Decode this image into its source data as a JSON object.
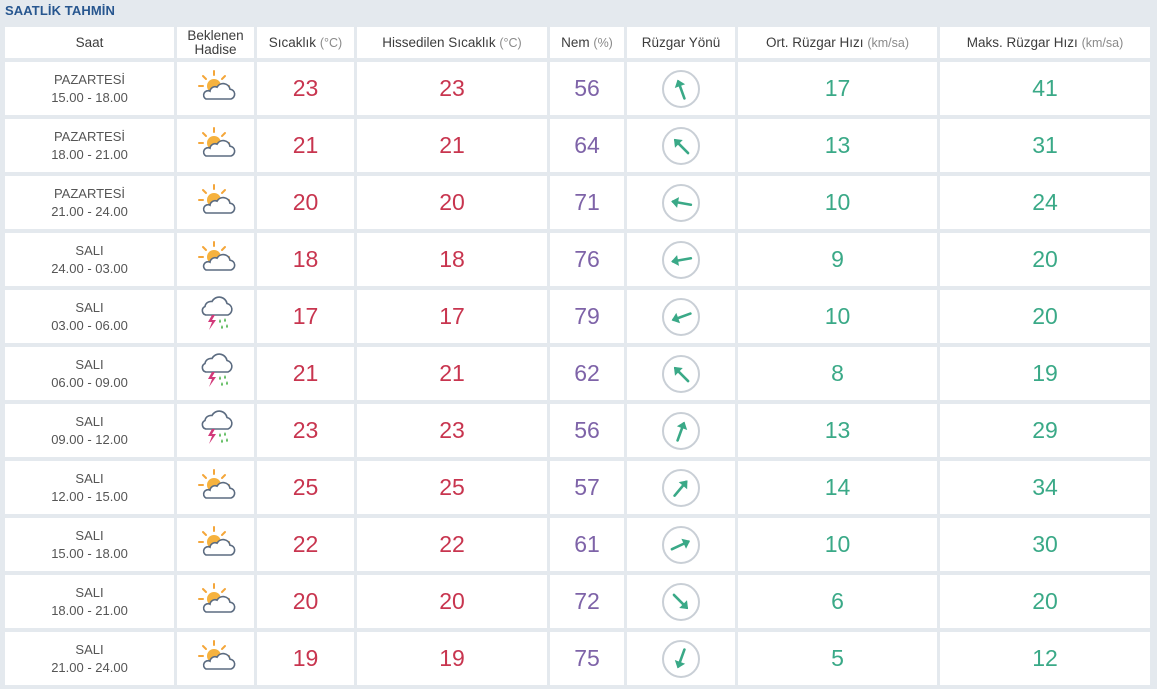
{
  "title": "SAATLİK TAHMİN",
  "headers": {
    "time": "Saat",
    "event_1": "Beklenen",
    "event_2": "Hadise",
    "temp": "Sıcaklık",
    "temp_unit": "(°C)",
    "feels": "Hissedilen Sıcaklık",
    "feels_unit": "(°C)",
    "hum": "Nem",
    "hum_unit": "(%)",
    "dir": "Rüzgar Yönü",
    "avg": "Ort. Rüzgar Hızı",
    "avg_unit": "(km/sa)",
    "max": "Maks. Rüzgar Hızı",
    "max_unit": "(km/sa)"
  },
  "colors": {
    "temp": "#c8354f",
    "humidity": "#7e63a8",
    "wind": "#3aa987",
    "title": "#27568f"
  },
  "rows": [
    {
      "day": "PAZARTESİ",
      "time": "15.00 - 18.00",
      "icon": "partly-sunny-icon",
      "temp": "23",
      "feels": "23",
      "hum": "56",
      "dir_deg": 160,
      "avg": "17",
      "max": "41"
    },
    {
      "day": "PAZARTESİ",
      "time": "18.00 - 21.00",
      "icon": "partly-sunny-icon",
      "temp": "21",
      "feels": "21",
      "hum": "64",
      "dir_deg": 135,
      "avg": "13",
      "max": "31"
    },
    {
      "day": "PAZARTESİ",
      "time": "21.00 - 24.00",
      "icon": "partly-sunny-icon",
      "temp": "20",
      "feels": "20",
      "hum": "71",
      "dir_deg": 100,
      "avg": "10",
      "max": "24"
    },
    {
      "day": "SALI",
      "time": "24.00 - 03.00",
      "icon": "partly-sunny-icon",
      "temp": "18",
      "feels": "18",
      "hum": "76",
      "dir_deg": 80,
      "avg": "9",
      "max": "20"
    },
    {
      "day": "SALI",
      "time": "03.00 - 06.00",
      "icon": "thunderstorm-icon",
      "temp": "17",
      "feels": "17",
      "hum": "79",
      "dir_deg": 70,
      "avg": "10",
      "max": "20"
    },
    {
      "day": "SALI",
      "time": "06.00 - 09.00",
      "icon": "thunderstorm-icon",
      "temp": "21",
      "feels": "21",
      "hum": "62",
      "dir_deg": 135,
      "avg": "8",
      "max": "19"
    },
    {
      "day": "SALI",
      "time": "09.00 - 12.00",
      "icon": "thunderstorm-icon",
      "temp": "23",
      "feels": "23",
      "hum": "56",
      "dir_deg": 200,
      "avg": "13",
      "max": "29"
    },
    {
      "day": "SALI",
      "time": "12.00 - 15.00",
      "icon": "partly-sunny-icon",
      "temp": "25",
      "feels": "25",
      "hum": "57",
      "dir_deg": 220,
      "avg": "14",
      "max": "34"
    },
    {
      "day": "SALI",
      "time": "15.00 - 18.00",
      "icon": "partly-sunny-icon",
      "temp": "22",
      "feels": "22",
      "hum": "61",
      "dir_deg": 245,
      "avg": "10",
      "max": "30"
    },
    {
      "day": "SALI",
      "time": "18.00 - 21.00",
      "icon": "partly-sunny-icon",
      "temp": "20",
      "feels": "20",
      "hum": "72",
      "dir_deg": 315,
      "avg": "6",
      "max": "20"
    },
    {
      "day": "SALI",
      "time": "21.00 - 24.00",
      "icon": "partly-sunny-icon",
      "temp": "19",
      "feels": "19",
      "hum": "75",
      "dir_deg": 20,
      "avg": "5",
      "max": "12"
    }
  ]
}
